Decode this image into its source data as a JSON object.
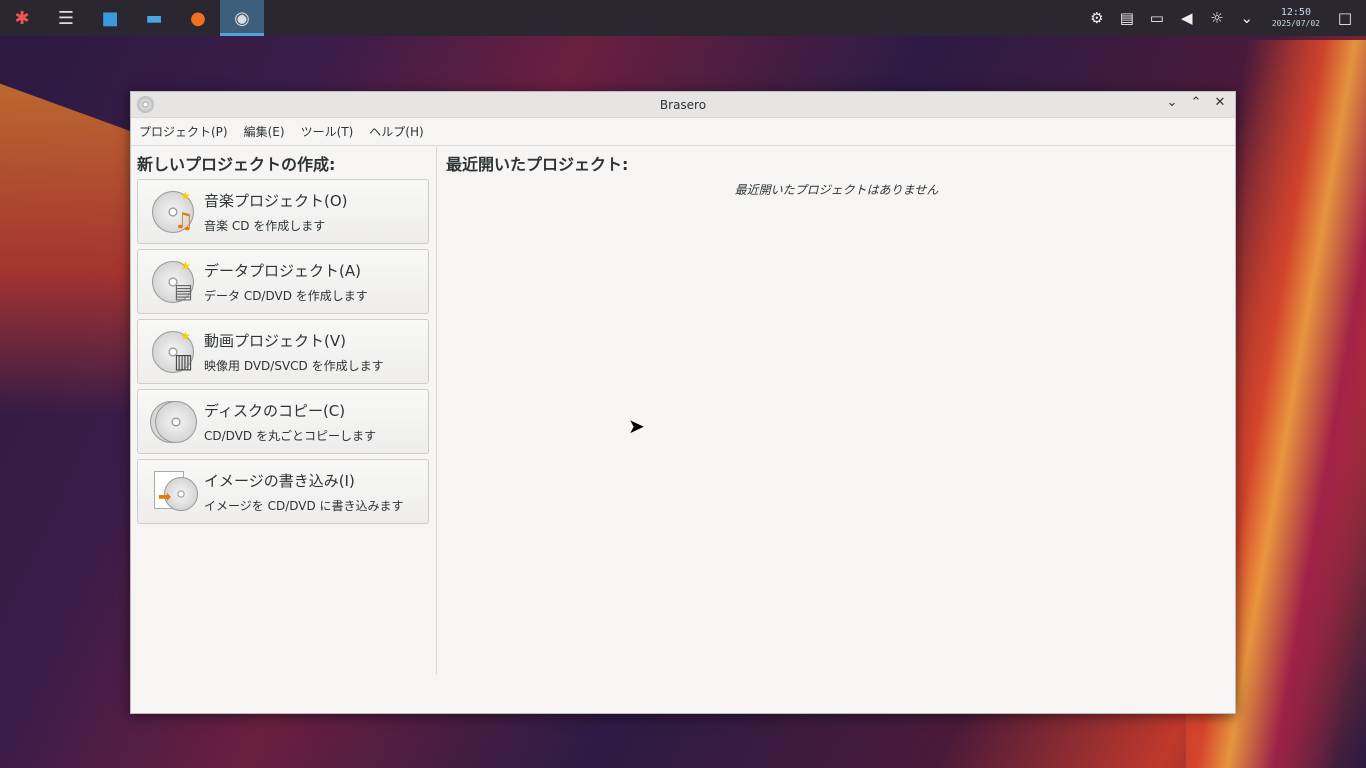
{
  "taskbar": {
    "apps": [
      "launcher-icon",
      "settings-icon",
      "store-icon",
      "files-icon",
      "firefox-icon",
      "brasero-icon"
    ],
    "clock_time": "12:50",
    "clock_date": "2025/07/02"
  },
  "window": {
    "title": "Brasero",
    "menu": [
      "プロジェクト(P)",
      "編集(E)",
      "ツール(T)",
      "ヘルプ(H)"
    ],
    "new_header": "新しいプロジェクトの作成:",
    "projects": [
      {
        "title": "音楽プロジェクト(O)",
        "desc": "音楽 CD を作成します",
        "icon": "music-project-icon"
      },
      {
        "title": "データプロジェクト(A)",
        "desc": "データ CD/DVD を作成します",
        "icon": "data-project-icon"
      },
      {
        "title": "動画プロジェクト(V)",
        "desc": "映像用 DVD/SVCD を作成します",
        "icon": "video-project-icon"
      },
      {
        "title": "ディスクのコピー(C)",
        "desc": "CD/DVD を丸ごとコピーします",
        "icon": "disc-copy-icon"
      },
      {
        "title": "イメージの書き込み(I)",
        "desc": "イメージを CD/DVD に書き込みます",
        "icon": "image-burn-icon"
      }
    ],
    "recent_header": "最近開いたプロジェクト:",
    "recent_empty": "最近開いたプロジェクトはありません"
  }
}
